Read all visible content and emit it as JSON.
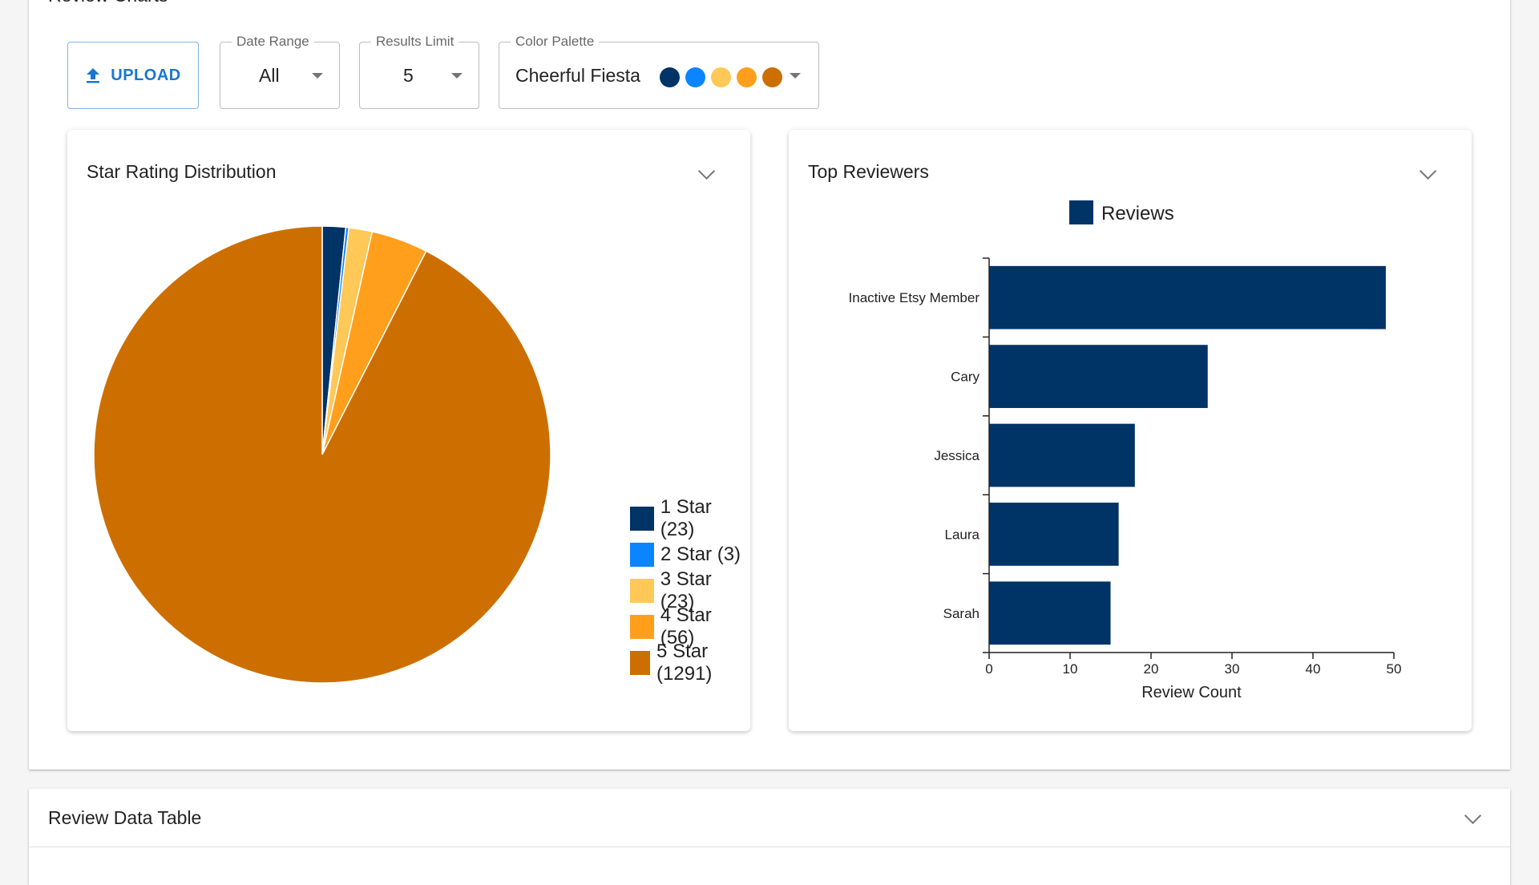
{
  "charts_section": {
    "title": "Review Charts"
  },
  "toolbar": {
    "upload_label": "UPLOAD",
    "date_range": {
      "label": "Date Range",
      "value": "All"
    },
    "results_limit": {
      "label": "Results Limit",
      "value": "5"
    },
    "color_palette": {
      "label": "Color Palette",
      "value": "Cheerful Fiesta",
      "swatches": [
        "#003366",
        "#0a84ff",
        "#ffc857",
        "#ff9f1c",
        "#cc6f00"
      ]
    }
  },
  "star_card": {
    "title": "Star Rating Distribution"
  },
  "reviewers_card": {
    "title": "Top Reviewers"
  },
  "table_section": {
    "title": "Review Data Table"
  },
  "chart_data": [
    {
      "type": "pie",
      "title": "Star Rating Distribution",
      "categories": [
        "1 Star",
        "2 Star",
        "3 Star",
        "4 Star",
        "5 Star"
      ],
      "values": [
        23,
        3,
        23,
        56,
        1291
      ],
      "legend_labels": [
        "1 Star (23)",
        "2 Star (3)",
        "3 Star (23)",
        "4 Star (56)",
        "5 Star (1291)"
      ],
      "colors": [
        "#003366",
        "#0a84ff",
        "#ffc857",
        "#ff9f1c",
        "#cc6f00"
      ],
      "legend": "right"
    },
    {
      "type": "bar",
      "orientation": "horizontal",
      "title": "Top Reviewers",
      "categories": [
        "Inactive Etsy Member",
        "Cary",
        "Jessica",
        "Laura",
        "Sarah"
      ],
      "series": [
        {
          "name": "Reviews",
          "values": [
            49,
            27,
            18,
            16,
            15
          ],
          "color": "#003366"
        }
      ],
      "xlabel": "Review Count",
      "ylabel": "",
      "xlim": [
        0,
        50
      ],
      "xticks": [
        0,
        10,
        20,
        30,
        40,
        50
      ],
      "grid": false,
      "legend": "top"
    }
  ]
}
